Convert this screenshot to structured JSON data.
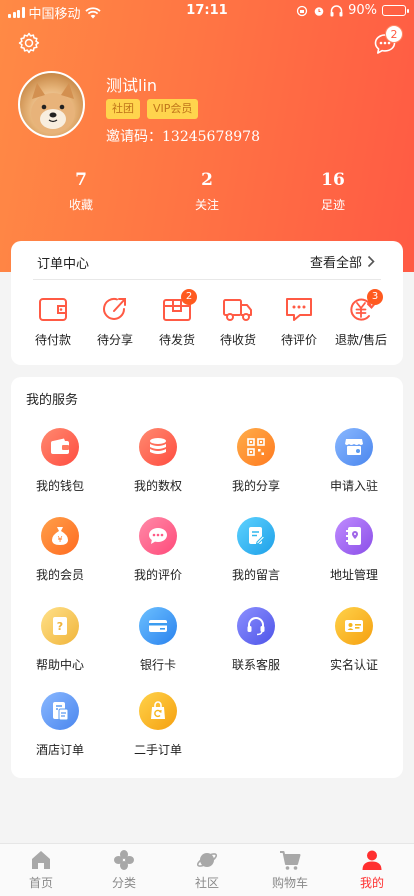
{
  "status_bar": {
    "carrier": "中国移动",
    "time": "17:11",
    "battery": "90%",
    "battery_level": 0.9
  },
  "header": {
    "message_badge": "2"
  },
  "profile": {
    "name": "测试lin",
    "tags": [
      "社团",
      "VIP会员"
    ],
    "invite_label": "邀请码：",
    "invite_code": "13245678978"
  },
  "stats": [
    {
      "value": "7",
      "label": "收藏"
    },
    {
      "value": "2",
      "label": "关注"
    },
    {
      "value": "16",
      "label": "足迹"
    }
  ],
  "order_center": {
    "title": "订单中心",
    "view_all": "查看全部",
    "items": [
      {
        "label": "待付款",
        "icon": "wallet-icon",
        "badge": ""
      },
      {
        "label": "待分享",
        "icon": "share-icon",
        "badge": ""
      },
      {
        "label": "待发货",
        "icon": "package-icon",
        "badge": "2"
      },
      {
        "label": "待收货",
        "icon": "truck-icon",
        "badge": ""
      },
      {
        "label": "待评价",
        "icon": "comment-icon",
        "badge": ""
      },
      {
        "label": "退款/售后",
        "icon": "refund-icon",
        "badge": "3"
      }
    ]
  },
  "services": {
    "title": "我的服务",
    "items": [
      {
        "label": "我的钱包",
        "icon": "wallet-icon",
        "color": "#ff5b4a"
      },
      {
        "label": "我的数权",
        "icon": "database-icon",
        "color": "#ff5b4a"
      },
      {
        "label": "我的分享",
        "icon": "qrcode-icon",
        "color": "#ff8a2b"
      },
      {
        "label": "申请入驻",
        "icon": "store-icon",
        "color": "#5b9bf0"
      },
      {
        "label": "我的会员",
        "icon": "money-bag-icon",
        "color": "#ff7a2b"
      },
      {
        "label": "我的评价",
        "icon": "chat-icon",
        "color": "#ff5a86"
      },
      {
        "label": "我的留言",
        "icon": "note-icon",
        "color": "#31b7ee"
      },
      {
        "label": "地址管理",
        "icon": "address-book-icon",
        "color": "#a066e8"
      },
      {
        "label": "帮助中心",
        "icon": "help-icon",
        "color": "#f3c04d"
      },
      {
        "label": "银行卡",
        "icon": "bank-card-icon",
        "color": "#3b9cf0"
      },
      {
        "label": "联系客服",
        "icon": "headset-icon",
        "color": "#6a6ff0"
      },
      {
        "label": "实名认证",
        "icon": "id-card-icon",
        "color": "#f5b51c"
      },
      {
        "label": "酒店订单",
        "icon": "hotel-order-icon",
        "color": "#5b9bf0"
      },
      {
        "label": "二手订单",
        "icon": "secondhand-icon",
        "color": "#f5b51c"
      }
    ]
  },
  "tabbar": {
    "items": [
      {
        "label": "首页",
        "icon": "home-icon",
        "active": false
      },
      {
        "label": "分类",
        "icon": "category-icon",
        "active": false
      },
      {
        "label": "社区",
        "icon": "planet-icon",
        "active": false
      },
      {
        "label": "购物车",
        "icon": "cart-icon",
        "active": false
      },
      {
        "label": "我的",
        "icon": "user-icon",
        "active": true
      }
    ]
  },
  "colors": {
    "accent": "#ff5a44",
    "header_gradient_start": "#ff8a45",
    "tag_bg": "#ffd44d",
    "active_tab": "#ff2f2f"
  }
}
